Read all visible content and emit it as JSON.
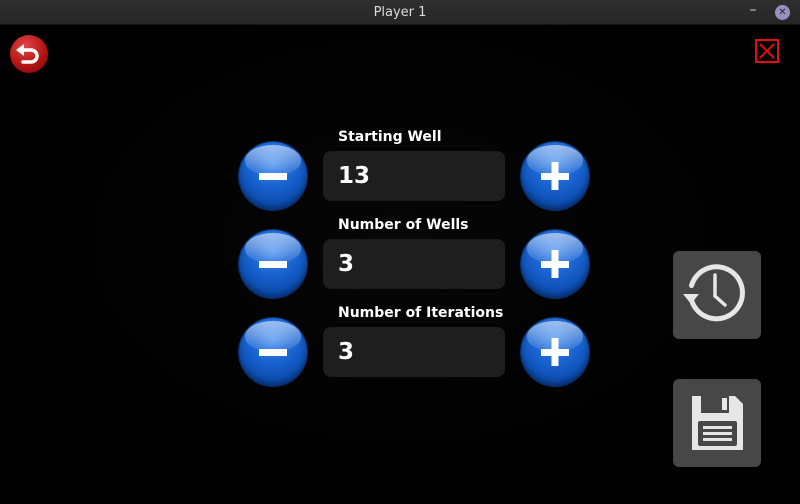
{
  "window": {
    "title": "Player 1",
    "minimize_glyph": "–",
    "close_glyph": "✕"
  },
  "toolbar": {
    "back_icon": "undo-arrow-icon",
    "exit_icon": "close-x-icon"
  },
  "fields": [
    {
      "label": "Starting Well",
      "value": "13"
    },
    {
      "label": "Number of Wells",
      "value": "3"
    },
    {
      "label": "Number of Iterations",
      "value": "3"
    }
  ],
  "side_buttons": {
    "history_icon": "history-icon",
    "save_icon": "save-icon"
  },
  "colors": {
    "background": "#000000",
    "field_box": "#1e1e1e",
    "stepper_blue": "#1a64d2",
    "back_red": "#b41414",
    "exit_red": "#e01010",
    "side_button": "#474747"
  }
}
